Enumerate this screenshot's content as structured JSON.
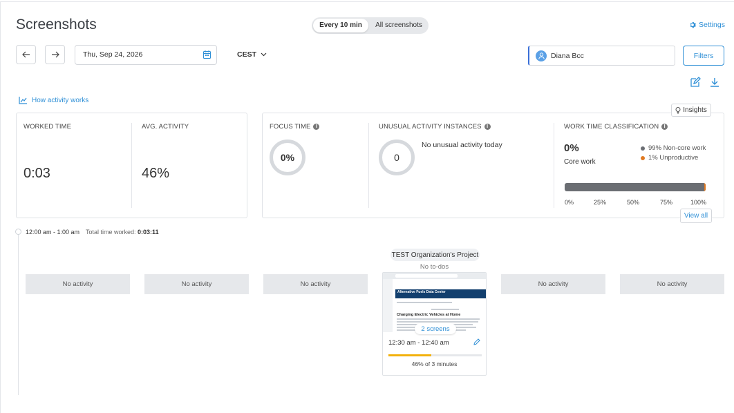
{
  "header": {
    "title": "Screenshots",
    "toggle": {
      "active": "Every 10 min",
      "other": "All screenshots"
    },
    "settings_label": "Settings"
  },
  "controls": {
    "date": "Thu, Sep 24, 2026",
    "timezone": "CEST",
    "user": "Diana Bcc",
    "filters_label": "Filters"
  },
  "how_activity_label": "How activity works",
  "stats": {
    "worked_time_label": "WORKED TIME",
    "worked_time": "0:03",
    "avg_activity_label": "AVG. ACTIVITY",
    "avg_activity": "46%",
    "focus_time_label": "FOCUS TIME",
    "focus_time": "0%",
    "unusual_label": "UNUSUAL ACTIVITY INSTANCES",
    "unusual_count": "0",
    "unusual_text": "No unusual activity today",
    "classification_label": "WORK TIME CLASSIFICATION",
    "core_pct": "0%",
    "core_label": "Core work",
    "legend": [
      {
        "label": "99% Non-core work",
        "color": "#6b6e73"
      },
      {
        "label": "1% Unproductive",
        "color": "#e07a22"
      }
    ],
    "unproductive_fraction": 0.01,
    "axis_ticks": [
      "0%",
      "25%",
      "50%",
      "75%",
      "100%"
    ],
    "insights_label": "Insights",
    "view_all_label": "View all"
  },
  "timeline": {
    "hour_range": "12:00 am - 1:00 am",
    "total_label": "Total time worked:",
    "total_value": "0:03:11",
    "no_activity": "No activity",
    "project": "TEST Organization's Project",
    "todos": "No to-dos",
    "screens_label": "2 screens",
    "shot_time": "12:30 am - 12:40 am",
    "activity_fraction": 0.46,
    "activity_text": "46% of 3 minutes",
    "thumb": {
      "site_title": "Alternative Fuels Data Center",
      "heading": "Charging Electric Vehicles at Home"
    }
  }
}
